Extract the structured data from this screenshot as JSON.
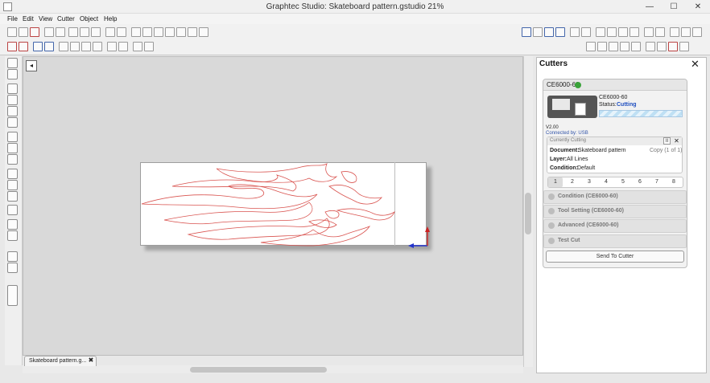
{
  "window": {
    "title": "Graphtec Studio: Skateboard pattern.gstudio 21%",
    "minimize": "—",
    "maximize": "☐",
    "close": "✕"
  },
  "menu": [
    "File",
    "Edit",
    "View",
    "Cutter",
    "Object",
    "Help"
  ],
  "document_tab": {
    "label": "Skateboard pattern.g...",
    "close": "✖"
  },
  "panel": {
    "title": "Cutters",
    "close": "✕",
    "cutter": {
      "name": "CE6000-60",
      "model": "CE6000-60",
      "status_label": "Status:",
      "status_value": "Cutting",
      "version": "V2.00",
      "connection": "Connected by: USB",
      "progress": 1.0
    },
    "current_job": {
      "header": "Currently Cutting",
      "document_label": "Document:",
      "document_value": "Skateboard pattern",
      "copy": "Copy (1 of 1)",
      "layer_label": "Layer:",
      "layer_value": "All Lines",
      "condition_label": "Condition:",
      "condition_value": "Default",
      "pause": "II",
      "stop": "✕"
    },
    "pages": [
      "1",
      "2",
      "3",
      "4",
      "5",
      "6",
      "7",
      "8"
    ],
    "sections": [
      "Condition (CE6000-60)",
      "Tool Setting (CE6000-60)",
      "Advanced (CE6000-60)",
      "Test Cut"
    ],
    "send_button": "Send To Cutter"
  },
  "colors": {
    "flame_stroke": "#d9534f",
    "status_blue": "#1f4fbf",
    "axis_blue": "#2233cc",
    "axis_red": "#cc2222"
  }
}
